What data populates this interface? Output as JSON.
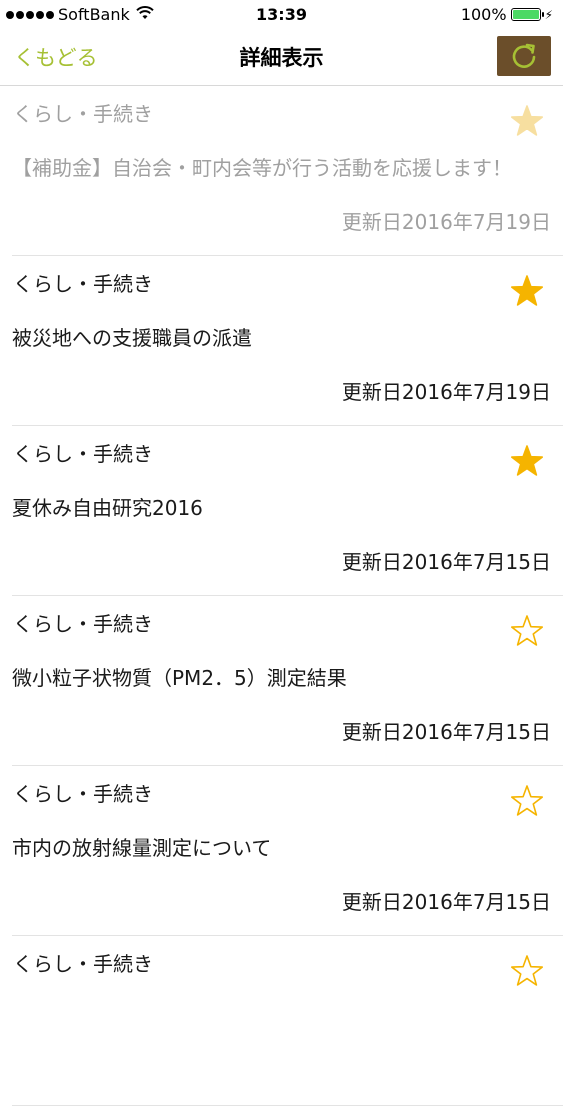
{
  "status_bar": {
    "carrier": "SoftBank",
    "time": "13:39",
    "battery": "100%"
  },
  "nav": {
    "back_label": "くもどる",
    "title": "詳細表示"
  },
  "colors": {
    "accent": "#a6c034",
    "star": "#f5b400",
    "refresh_bg": "#6b4e2a"
  },
  "items": [
    {
      "category": "くらし・手続き",
      "title": "【補助金】自治会・町内会等が行う活動を応援します！",
      "date": "更新日2016年7月19日",
      "starred": true
    },
    {
      "category": "くらし・手続き",
      "title": "被災地への支援職員の派遣",
      "date": "更新日2016年7月19日",
      "starred": true
    },
    {
      "category": "くらし・手続き",
      "title": "夏休み自由研究2016",
      "date": "更新日2016年7月15日",
      "starred": true
    },
    {
      "category": "くらし・手続き",
      "title": "微小粒子状物質（PM2．5）測定結果",
      "date": "更新日2016年7月15日",
      "starred": false
    },
    {
      "category": "くらし・手続き",
      "title": "市内の放射線量測定について",
      "date": "更新日2016年7月15日",
      "starred": false
    },
    {
      "category": "くらし・手続き",
      "title": "",
      "date": "",
      "starred": false
    }
  ]
}
